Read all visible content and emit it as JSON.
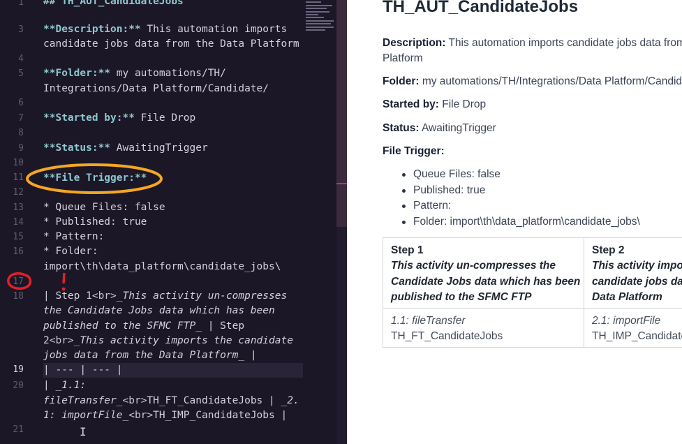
{
  "editor": {
    "line_numbers": [
      "1",
      "3",
      "4",
      "5",
      "6",
      "7",
      "8",
      "9",
      "10",
      "11",
      "12",
      "13",
      "14",
      "15",
      "16",
      "17",
      "18",
      "19",
      "20",
      "21"
    ],
    "lines": {
      "l1": "## TH_AUT_CandidateJobs",
      "l3a_bold": "**Description:**",
      "l3a_rest": " This automation imports",
      "l3b": "candidate jobs data from the Data Platform",
      "l5a_bold": "**Folder:**",
      "l5a_rest": " my automations/TH/",
      "l5b": "Integrations/Data Platform/Candidate/",
      "l7_bold": "**Started by:**",
      "l7_rest": " File Drop",
      "l9_bold": "**Status:**",
      "l9_rest": " AwaitingTrigger",
      "l11_bold": "**File Trigger:**",
      "l13": "* Queue Files: false",
      "l14": "* Published: true",
      "l15": "* Pattern:",
      "l16a": "* Folder:",
      "l16b": "import\\th\\data_platform\\candidate_jobs\\",
      "l18a_pre": "| Step 1",
      "l18a_tag": "<br>",
      "l18a_it": "_This activity un-compresses",
      "l18b_it": "the Candidate Jobs data which has been",
      "l18c_it": "published to the SFMC FTP_",
      "l18c_rest": " | Step",
      "l18d_pre": "2",
      "l18d_tag": "<br>",
      "l18d_it": "_This activity imports the candidate",
      "l18e_it": "jobs data from the Data Platform_",
      "l18e_rest": " |",
      "l19": "| --- | --- |",
      "l20a_pre": "| ",
      "l20a_it": "_1.1:",
      "l20b_it": "fileTransfer_",
      "l20b_tag": "<br>",
      "l20b_rest": "TH_FT_CandidateJobs | ",
      "l20b_it2": "_2.",
      "l20c_it": "1: importFile_",
      "l20c_tag": "<br>",
      "l20c_rest": "TH_IMP_CandidateJobs |"
    },
    "annotation_mark": "!",
    "text_cursor_glyph": "I"
  },
  "preview": {
    "title": "TH_AUT_CandidateJobs",
    "description_label": "Description:",
    "description_text1": " This automation imports candidate jobs data from",
    "description_text2": "Platform",
    "folder_label": "Folder:",
    "folder_text": " my automations/TH/Integrations/Data Platform/Candid",
    "started_label": "Started by:",
    "started_text": " File Drop",
    "status_label": "Status:",
    "status_text": " AwaitingTrigger",
    "trigger_label": "File Trigger:",
    "bullets": [
      "Queue Files: false",
      "Published: true",
      "Pattern:",
      "Folder: import\\th\\data_platform\\candidate_jobs\\"
    ],
    "table": {
      "step1_title": "Step 1",
      "step1_desc": [
        "This activity un-compresses the",
        "Candidate Jobs data which has been",
        "published to the SFMC FTP"
      ],
      "step2_title": "Step 2",
      "step2_desc": [
        "This activity impo",
        "candidate jobs da",
        "Data Platform"
      ],
      "row1_c1_label": "1.1: fileTransfer",
      "row1_c1_value": "TH_FT_CandidateJobs",
      "row1_c2_label": "2.1: importFile",
      "row1_c2_value": "TH_IMP_CandidateJ"
    }
  },
  "colors": {
    "editor_bg": "#1b1726",
    "bold_text": "#8fc6cf",
    "annotation_orange": "#f5a623",
    "annotation_red": "#e0202a",
    "scroll_marker": "#c0345c"
  }
}
